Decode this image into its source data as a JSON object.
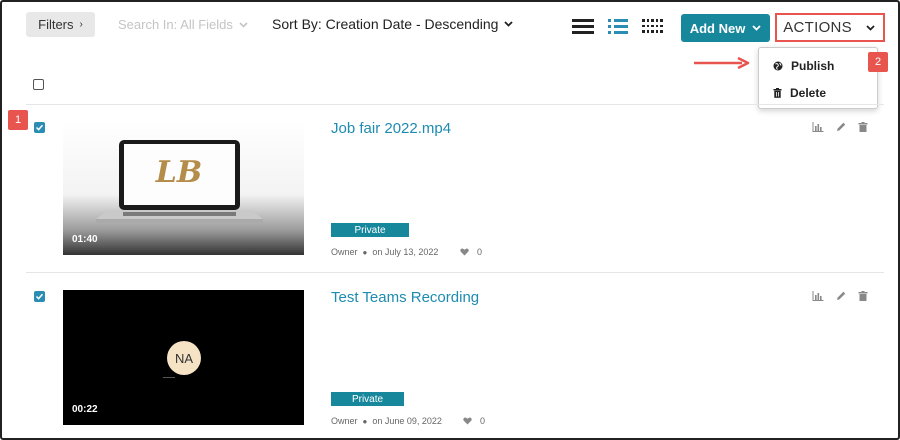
{
  "toolbar": {
    "filters_label": "Filters",
    "search_in_label": "Search In: All Fields",
    "sort_label": "Sort By: Creation Date - Descending",
    "add_new_label": "Add New",
    "actions_label": "ACTIONS"
  },
  "actions_menu": {
    "items": [
      {
        "label": "Publish",
        "icon": "globe-icon"
      },
      {
        "label": "Delete",
        "icon": "trash-icon"
      }
    ]
  },
  "callouts": {
    "one": "1",
    "two": "2"
  },
  "entries": [
    {
      "title": "Job fair 2022.mp4",
      "duration": "01:40",
      "status": "Private",
      "owner": "Owner",
      "date": "on July 13, 2022",
      "likes": "0",
      "checked": true
    },
    {
      "title": "Test Teams Recording",
      "duration": "00:22",
      "status": "Private",
      "owner": "Owner",
      "date": "on June 09, 2022",
      "likes": "0",
      "checked": true,
      "avatar_initials": "NA"
    }
  ],
  "colors": {
    "accent": "#17879b",
    "link": "#1e8bb0",
    "callout": "#e8554f",
    "checkbox": "#2a8db3"
  }
}
